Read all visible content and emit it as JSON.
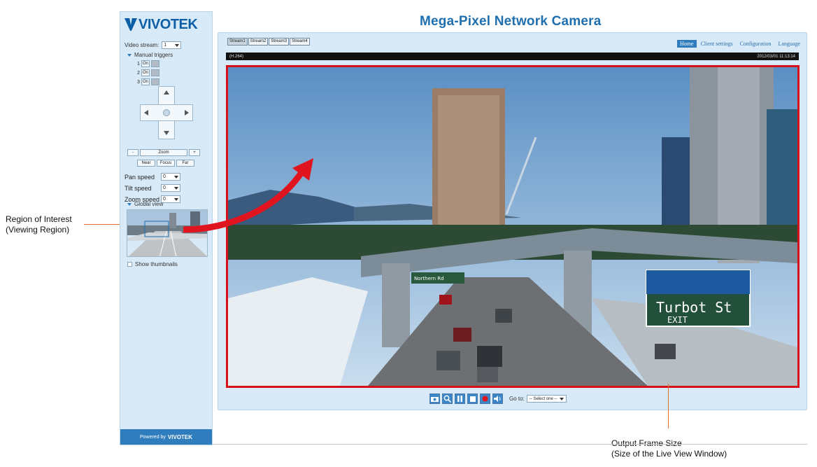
{
  "app": {
    "brand": "VIVOTEK",
    "title": "Mega-Pixel Network Camera"
  },
  "sidebar": {
    "video_stream_label": "Video stream:",
    "video_stream_value": "1",
    "manual_trigger_label": "Manual triggers",
    "triggers": [
      {
        "num": "1",
        "on": "On",
        "off": ""
      },
      {
        "num": "2",
        "on": "On",
        "off": ""
      },
      {
        "num": "3",
        "on": "On",
        "off": ""
      }
    ],
    "zoom_buttons": [
      "-",
      "Zoom",
      "+"
    ],
    "focus_buttons": [
      "Near",
      "Focus",
      "Far"
    ],
    "pan_speed_label": "Pan speed",
    "pan_speed_value": "0",
    "tilt_speed_label": "Tilt speed",
    "tilt_speed_value": "0",
    "zoom_speed_label": "Zoom speed",
    "zoom_speed_value": "0",
    "global_view_label": "Global view",
    "show_all_label": "Show thumbnails",
    "footer_powered": "Powered by",
    "footer_brand": "VIVOTEK"
  },
  "stream_tabs": [
    "Stream1",
    "Stream2",
    "Stream3",
    "Stream4"
  ],
  "nav": {
    "items": [
      {
        "label": "Home",
        "active": true
      },
      {
        "label": "Client settings",
        "active": false
      },
      {
        "label": "Configuration",
        "active": false
      },
      {
        "label": "Language",
        "active": false
      }
    ]
  },
  "video": {
    "stream_name": "(H.264)",
    "timestamp": "2012/03/01 11:13:14",
    "sign_text_1": "Turbot St",
    "sign_text_2": "EXIT",
    "small_sign_text": "Northern Rd"
  },
  "controls": {
    "goto_label": "Go to:",
    "goto_value": "-- Select one --"
  },
  "annotations": {
    "roi_line1": "Region of Interest",
    "roi_line2": "(Viewing Region)",
    "output_line1": "Output Frame Size",
    "output_line2": "(Size of the Live View Window)"
  },
  "colors": {
    "brand_blue": "#1f6fae",
    "panel_bg": "#d8eaf7",
    "roi_border": "#d8101a",
    "arrow_red": "#e0141f",
    "leader_orange": "#e0702a"
  },
  "icons": [
    "snapshot-icon",
    "digital-zoom-icon",
    "pause-icon",
    "stop-icon",
    "record-icon",
    "volume-icon"
  ]
}
